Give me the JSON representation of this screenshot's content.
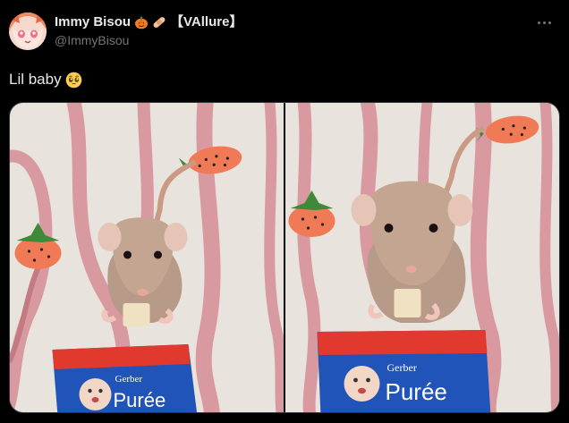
{
  "author": {
    "display_name": "Immy Bisou",
    "tag": "【VAllure】",
    "handle": "@ImmyBisou",
    "badges": [
      "pumpkin-emoji",
      "bandage-emoji"
    ]
  },
  "tweet": {
    "text": "Lil baby",
    "emoji": "pleading-face-emoji"
  },
  "media": {
    "count": 2,
    "package_brand": "Gerber",
    "package_product": "Purée"
  },
  "colors": {
    "background": "#000000",
    "text_primary": "#e7e9ea",
    "text_secondary": "#71767b",
    "border": "#2f3336"
  }
}
